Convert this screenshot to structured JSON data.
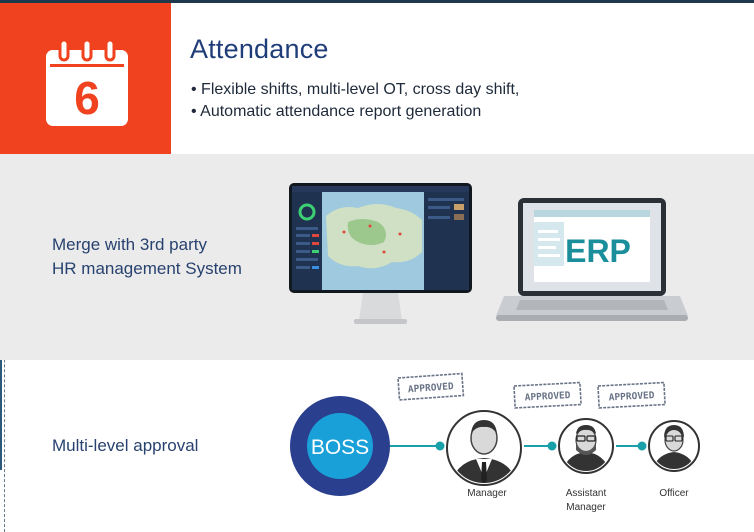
{
  "header": {
    "calendar_number": "6",
    "title": "Attendance",
    "bullets": [
      "• Flexible shifts, multi-level OT, cross day shift,",
      "• Automatic attendance report generation"
    ]
  },
  "integration": {
    "text_line1": "Merge with 3rd party",
    "text_line2": "HR management System",
    "erp_label": "ERP"
  },
  "approval": {
    "text": "Multi-level approval",
    "boss_label": "BOSS",
    "stamp_label": "APPROVED",
    "people": [
      {
        "line1": "Manager",
        "line2": ""
      },
      {
        "line1": "Assistant",
        "line2": "Manager"
      },
      {
        "line1": "Officer",
        "line2": ""
      }
    ]
  },
  "colors": {
    "accent_red": "#f0421e",
    "navy": "#1f3d78",
    "teal": "#1aa0a8",
    "boss_ring": "#2b3f8f",
    "gray_band": "#ebebeb"
  }
}
